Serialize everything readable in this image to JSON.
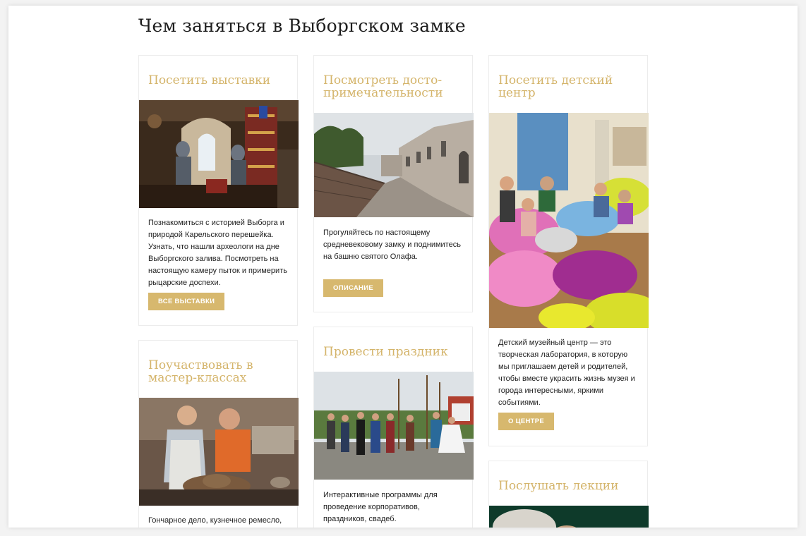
{
  "page_title": "Чем заняться в Выборгском замке",
  "cards": {
    "exhibitions": {
      "title": "Посетить выставки",
      "description": "Познакомиться с историей Выборга и природой Карельского перешейка. Узнать, что нашли археологи на дне Выборгского залива. Посмотреть на настоящую камеру пыток и примерить рыцарские доспехи.",
      "button": "Все выставки"
    },
    "sights": {
      "title": "Посмотреть досто-примечательности",
      "description": "Прогуляйтесь по настоящему средневековому замку и поднимитесь на башню святого Олафа.",
      "button": "Описание"
    },
    "kids_center": {
      "title": "Посетить детский центр",
      "description": "Детский музейный центр — это творческая лаборатория, в которую мы приглашаем детей и родителей, чтобы вместе украсить жизнь музея и города интересными, яркими событиями.",
      "button": "О центре"
    },
    "masterclasses": {
      "title": "Поучаствовать в мастер-классах",
      "description": "Гончарное дело, кузнечное ремесло,"
    },
    "holiday": {
      "title": "Провести праздник",
      "description": "Интерактивные программы для проведение корпоративов, праздников, свадеб."
    },
    "lectures": {
      "title": "Послушать лекции"
    }
  },
  "colors": {
    "accent": "#d7b86e",
    "heading_gold": "#d4b46a",
    "text": "#222222"
  }
}
